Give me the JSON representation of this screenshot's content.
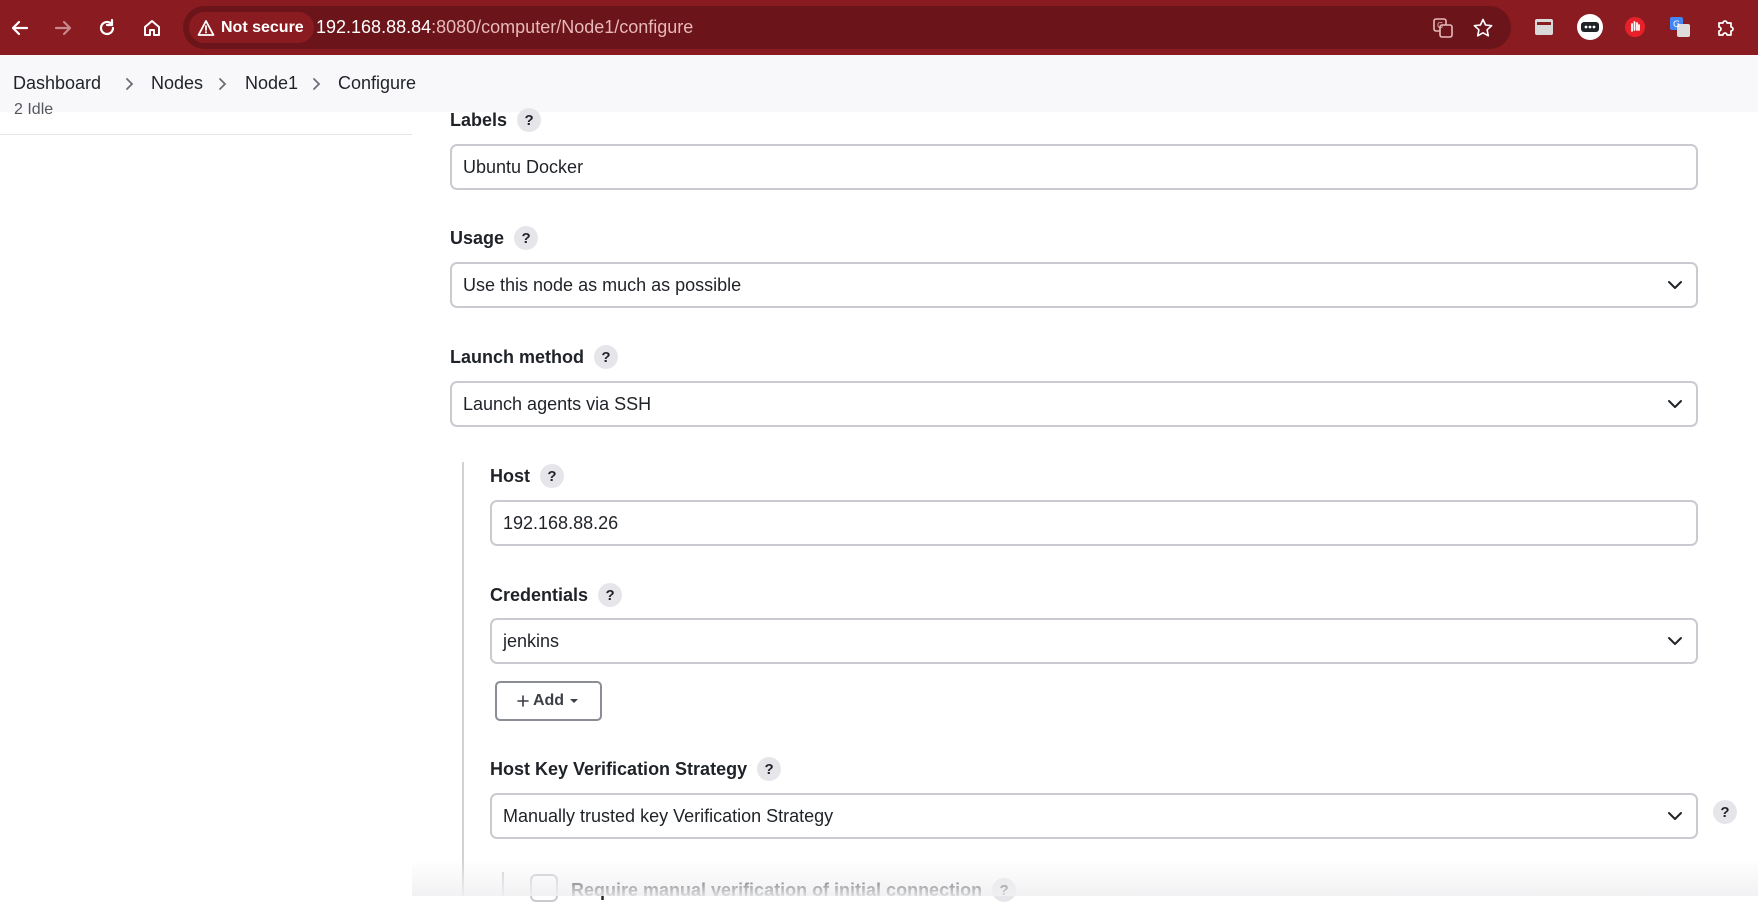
{
  "browser": {
    "security_label": "Not secure",
    "url_host": "192.168.88.84",
    "url_rest": ":8080/computer/Node1/configure"
  },
  "breadcrumb": {
    "items": [
      "Dashboard",
      "Nodes",
      "Node1",
      "Configure"
    ]
  },
  "side_panel": {
    "executor_row": "2  Idle"
  },
  "form": {
    "labels": {
      "label": "Labels",
      "value": "Ubuntu Docker"
    },
    "usage": {
      "label": "Usage",
      "value": "Use this node as much as possible"
    },
    "launch_method": {
      "label": "Launch method",
      "value": "Launch agents via SSH"
    },
    "host": {
      "label": "Host",
      "value": "192.168.88.26"
    },
    "credentials": {
      "label": "Credentials",
      "value": "jenkins",
      "add_label": "Add"
    },
    "host_key": {
      "label": "Host Key Verification Strategy",
      "value": "Manually trusted key Verification Strategy"
    },
    "manual_verification": {
      "label": "Require manual verification of initial connection",
      "checked": false
    },
    "help_glyph": "?"
  },
  "colors": {
    "chrome_bg": "#8a1c21",
    "omnibox_bg": "#6b1419",
    "breadcrumb_bg": "#f8f8fa",
    "field_border": "#c9cbd0"
  }
}
